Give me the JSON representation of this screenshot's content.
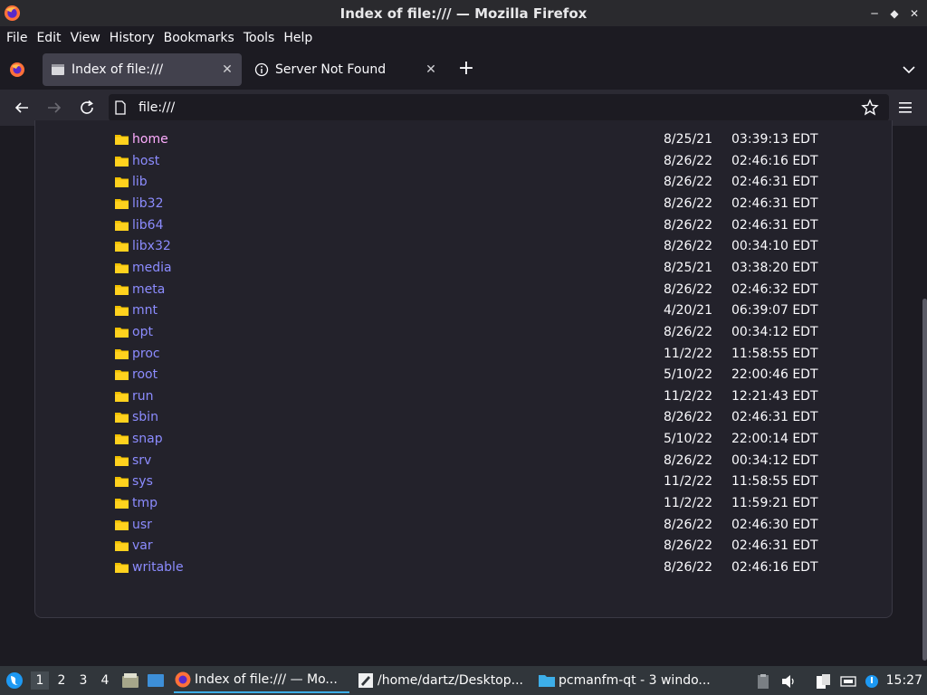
{
  "window": {
    "title": "Index of file:/// — Mozilla Firefox"
  },
  "menu": {
    "file": "File",
    "edit": "Edit",
    "view": "View",
    "history": "History",
    "bookmarks": "Bookmarks",
    "tools": "Tools",
    "help": "Help"
  },
  "tabs": [
    {
      "label": "Index of file:///",
      "icon": "page-icon"
    },
    {
      "label": "Server Not Found",
      "icon": "info-icon"
    }
  ],
  "url": {
    "value": "file:///"
  },
  "listing": {
    "rows": [
      {
        "name": "home",
        "date": "8/25/21",
        "time": "03:39:13 EDT",
        "visited": true
      },
      {
        "name": "host",
        "date": "8/26/22",
        "time": "02:46:16 EDT"
      },
      {
        "name": "lib",
        "date": "8/26/22",
        "time": "02:46:31 EDT"
      },
      {
        "name": "lib32",
        "date": "8/26/22",
        "time": "02:46:31 EDT"
      },
      {
        "name": "lib64",
        "date": "8/26/22",
        "time": "02:46:31 EDT"
      },
      {
        "name": "libx32",
        "date": "8/26/22",
        "time": "00:34:10 EDT"
      },
      {
        "name": "media",
        "date": "8/25/21",
        "time": "03:38:20 EDT"
      },
      {
        "name": "meta",
        "date": "8/26/22",
        "time": "02:46:32 EDT"
      },
      {
        "name": "mnt",
        "date": "4/20/21",
        "time": "06:39:07 EDT"
      },
      {
        "name": "opt",
        "date": "8/26/22",
        "time": "00:34:12 EDT"
      },
      {
        "name": "proc",
        "date": "11/2/22",
        "time": "11:58:55 EDT"
      },
      {
        "name": "root",
        "date": "5/10/22",
        "time": "22:00:46 EDT"
      },
      {
        "name": "run",
        "date": "11/2/22",
        "time": "12:21:43 EDT"
      },
      {
        "name": "sbin",
        "date": "8/26/22",
        "time": "02:46:31 EDT"
      },
      {
        "name": "snap",
        "date": "5/10/22",
        "time": "22:00:14 EDT"
      },
      {
        "name": "srv",
        "date": "8/26/22",
        "time": "00:34:12 EDT"
      },
      {
        "name": "sys",
        "date": "11/2/22",
        "time": "11:58:55 EDT"
      },
      {
        "name": "tmp",
        "date": "11/2/22",
        "time": "11:59:21 EDT"
      },
      {
        "name": "usr",
        "date": "8/26/22",
        "time": "02:46:30 EDT"
      },
      {
        "name": "var",
        "date": "8/26/22",
        "time": "02:46:31 EDT"
      },
      {
        "name": "writable",
        "date": "8/26/22",
        "time": "02:46:16 EDT"
      }
    ]
  },
  "taskbar": {
    "desktops": [
      "1",
      "2",
      "3",
      "4"
    ],
    "tasks": [
      {
        "label": "Index of file:/// — Mo...",
        "icon": "firefox-icon"
      },
      {
        "label": "/home/dartz/Desktop...",
        "icon": "text-editor-icon"
      },
      {
        "label": "pcmanfm-qt - 3 windo...",
        "icon": "folder-icon"
      }
    ],
    "clock": "15:27"
  },
  "colors": {
    "link": "#8c8cff",
    "visited": "#ffadff",
    "accent": "#3daee9"
  }
}
